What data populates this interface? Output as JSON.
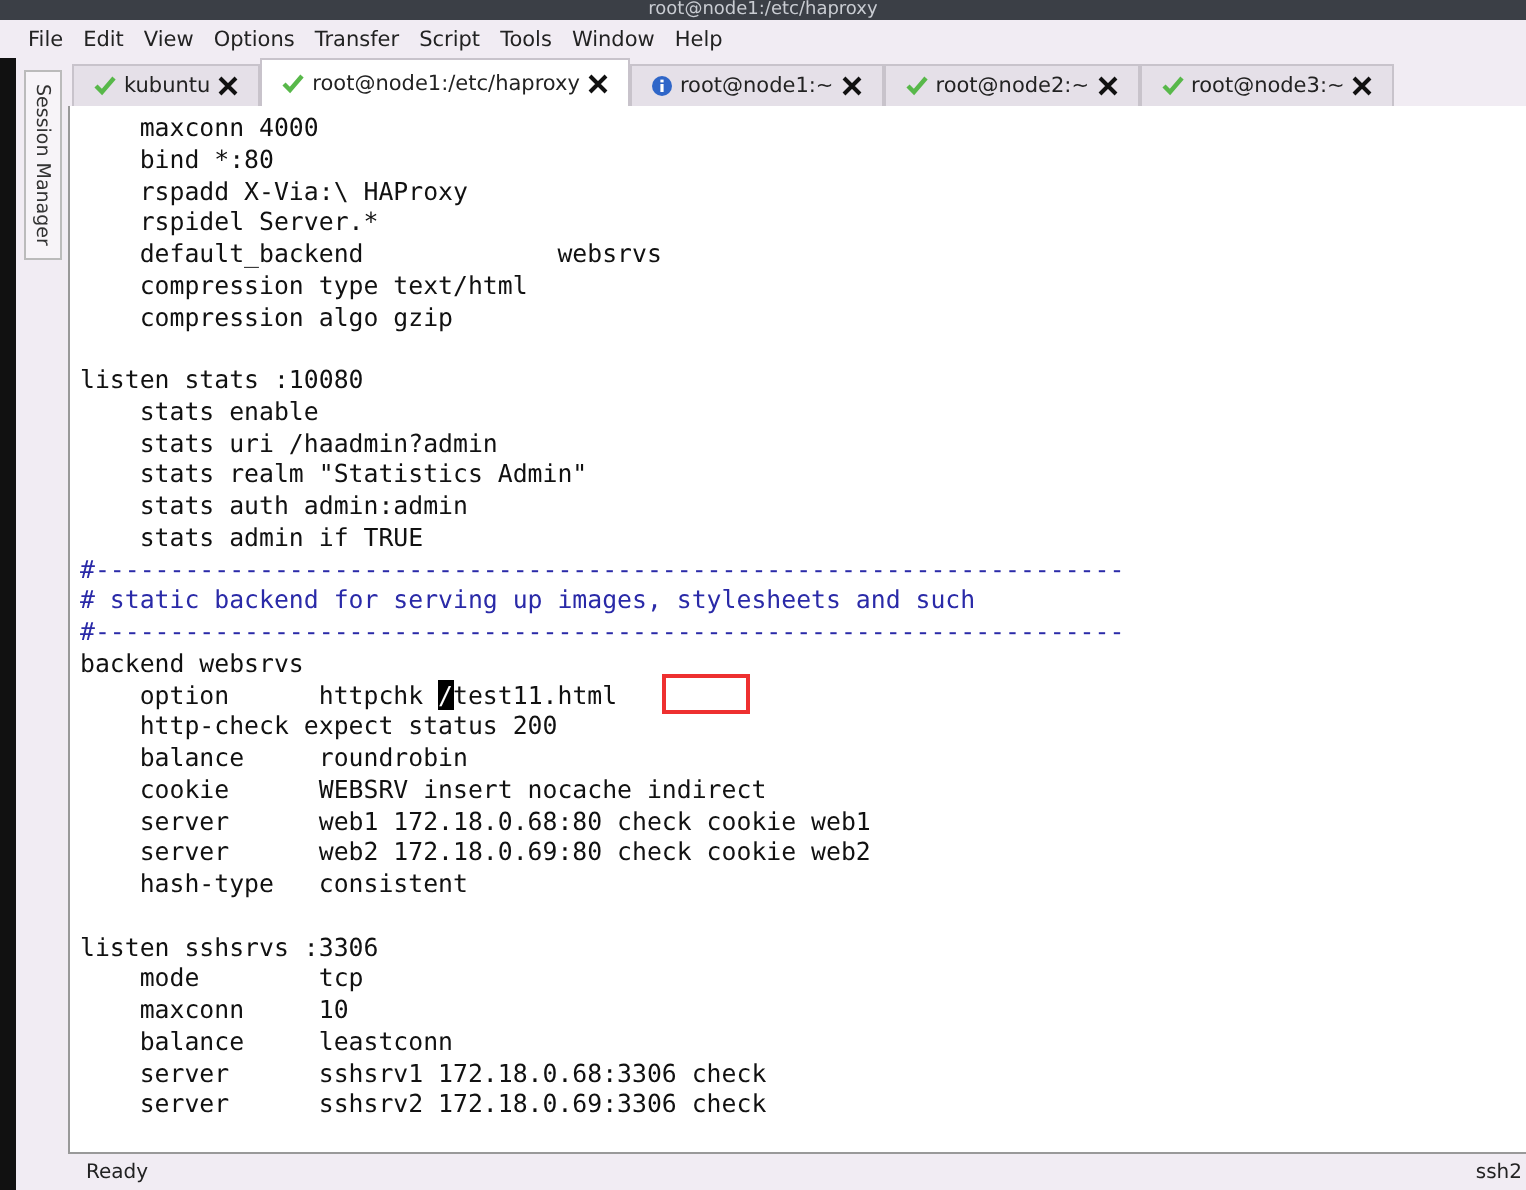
{
  "window": {
    "title": "root@node1:/etc/haproxy"
  },
  "menu": [
    "File",
    "Edit",
    "View",
    "Options",
    "Transfer",
    "Script",
    "Tools",
    "Window",
    "Help"
  ],
  "side_tab": {
    "label": "Session Manager"
  },
  "tabs": [
    {
      "label": "kubuntu",
      "kind": "ok",
      "selected": false
    },
    {
      "label": "root@node1:/etc/haproxy",
      "kind": "ok",
      "selected": true
    },
    {
      "label": "root@node1:~",
      "kind": "info",
      "selected": false
    },
    {
      "label": "root@node2:~",
      "kind": "ok",
      "selected": false
    },
    {
      "label": "root@node3:~",
      "kind": "ok",
      "selected": false
    }
  ],
  "terminal": {
    "lines": [
      {
        "kind": "text",
        "text": "    maxconn 4000"
      },
      {
        "kind": "text",
        "text": "    bind *:80"
      },
      {
        "kind": "text",
        "text": "    rspadd X-Via:\\ HAProxy"
      },
      {
        "kind": "text",
        "text": "    rspidel Server.*"
      },
      {
        "kind": "text",
        "text": "    default_backend             websrvs"
      },
      {
        "kind": "text",
        "text": "    compression type text/html"
      },
      {
        "kind": "text",
        "text": "    compression algo gzip"
      },
      {
        "kind": "blank"
      },
      {
        "kind": "text",
        "text": "listen stats :10080"
      },
      {
        "kind": "text",
        "text": "    stats enable"
      },
      {
        "kind": "text",
        "text": "    stats uri /haadmin?admin"
      },
      {
        "kind": "text",
        "text": "    stats realm \"Statistics Admin\""
      },
      {
        "kind": "text",
        "text": "    stats auth admin:admin"
      },
      {
        "kind": "text",
        "text": "    stats admin if TRUE"
      },
      {
        "kind": "comment",
        "text": "#---------------------------------------------------------------------"
      },
      {
        "kind": "comment",
        "text": "# static backend for serving up images, stylesheets and such"
      },
      {
        "kind": "comment",
        "text": "#---------------------------------------------------------------------"
      },
      {
        "kind": "text",
        "text": "backend websrvs"
      },
      {
        "kind": "cursor",
        "before": "    option      httpchk ",
        "cursor": "/",
        "after": "test11.html"
      },
      {
        "kind": "text",
        "text": "    http-check expect status 200"
      },
      {
        "kind": "text",
        "text": "    balance     roundrobin"
      },
      {
        "kind": "text",
        "text": "    cookie      WEBSRV insert nocache indirect"
      },
      {
        "kind": "text",
        "text": "    server      web1 172.18.0.68:80 check cookie web1"
      },
      {
        "kind": "text",
        "text": "    server      web2 172.18.0.69:80 check cookie web2"
      },
      {
        "kind": "text",
        "text": "    hash-type   consistent"
      },
      {
        "kind": "blank"
      },
      {
        "kind": "text",
        "text": "listen sshsrvs :3306"
      },
      {
        "kind": "text",
        "text": "    mode        tcp"
      },
      {
        "kind": "text",
        "text": "    maxconn     10"
      },
      {
        "kind": "text",
        "text": "    balance     leastconn"
      },
      {
        "kind": "text",
        "text": "    server      sshsrv1 172.18.0.68:3306 check"
      },
      {
        "kind": "text",
        "text": "    server      sshsrv2 172.18.0.69:3306 check"
      }
    ]
  },
  "status_bar": {
    "left": "Ready",
    "right": "ssh2"
  }
}
